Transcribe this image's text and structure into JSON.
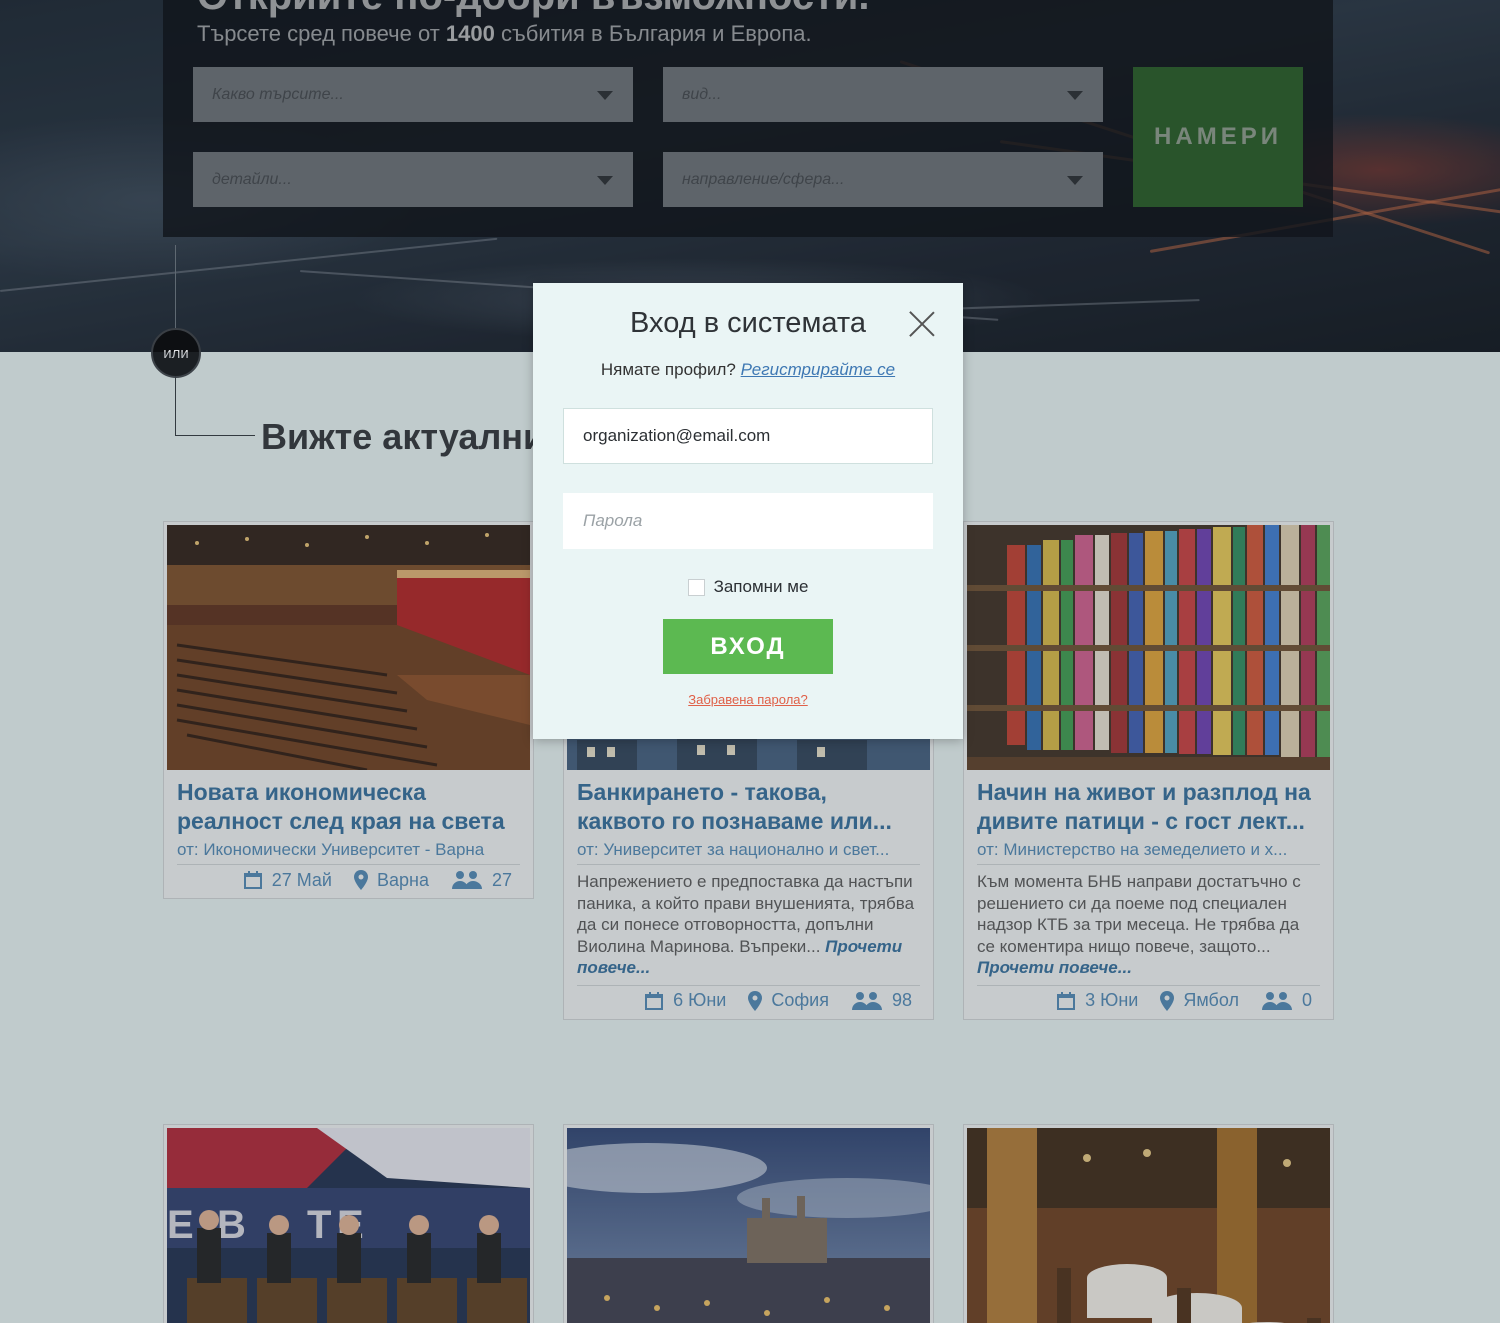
{
  "hero": {
    "headline": "Открийте по-добри възможности.",
    "sub_prefix": "Търсете сред повече от",
    "sub_count": "1400",
    "sub_suffix": "събития в България и Европа.",
    "search": {
      "what_placeholder": "Какво търсите...",
      "type_placeholder": "вид...",
      "details_placeholder": "детайли...",
      "field_placeholder": "направление/сфера...",
      "find_label": "НАМЕРИ"
    }
  },
  "connector": {
    "or_label": "или"
  },
  "section": {
    "title": "Вижте актуални"
  },
  "modal": {
    "title": "Вход в системата",
    "no_profile": "Нямате профил?",
    "register_link": "Регистрирайте се",
    "email_value": "organization@email.com",
    "password_placeholder": "Парола",
    "remember_label": "Запомни ме",
    "login_label": "ВХОД",
    "forgot_link": "Забравена парола?"
  },
  "cards": [
    {
      "title": "Новата икономическа реалност след края на света",
      "org": "от: Икономически Университет - Варна",
      "description": "",
      "more": "",
      "date": "27 Май",
      "city": "Варна",
      "attendees": "27"
    },
    {
      "title": "Банкирането - такова, каквото го познаваме или...",
      "org": "от: Университет за национално и свет...",
      "description": "Напрежението е предпоставка да настъпи паника, а който прави внушенията, трябва да си понесе отговорността, допълни Виолина Маринова. Въпреки...",
      "more": "Прочети повече...",
      "date": "6 Юни",
      "city": "София",
      "attendees": "98"
    },
    {
      "title": "Начин на живот и разплод на дивите патици - с гост лект...",
      "org": "от: Министерство на земеделието и х...",
      "description": "Към момента БНБ направи достатъчно с решението си да поеме под специален надзор КТБ за три месеца. Не трябва да се коментира нищо повече, защото...",
      "more": "Прочети повече...",
      "date": "3 Юни",
      "city": "Ямбол",
      "attendees": "0"
    }
  ],
  "colors": {
    "accent_green": "#5cb951",
    "link_blue": "#2f6b9a",
    "forgot_red": "#e06048"
  },
  "icons": [
    "calendar-icon",
    "location-pin-icon",
    "people-icon",
    "close-icon",
    "caret-down-icon"
  ]
}
